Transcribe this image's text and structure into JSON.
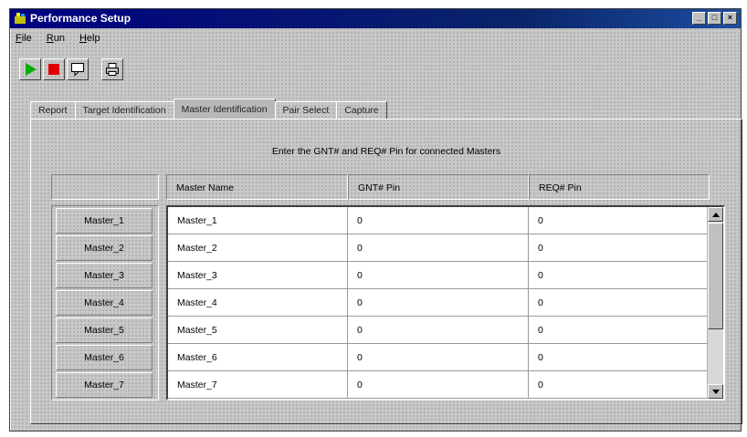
{
  "window": {
    "title": "Performance Setup"
  },
  "menu": [
    {
      "accel": "F",
      "rest": "ile"
    },
    {
      "accel": "R",
      "rest": "un"
    },
    {
      "accel": "H",
      "rest": "elp"
    }
  ],
  "toolbar": {
    "run_icon": "play-icon",
    "stop_icon": "stop-icon",
    "config_icon": "chat-icon",
    "print_icon": "printer-icon",
    "colors": {
      "run": "#00b000",
      "stop": "#e00000"
    }
  },
  "tabs": [
    {
      "label": "Report"
    },
    {
      "label": "Target Identification"
    },
    {
      "label": "Master Identification"
    },
    {
      "label": "Pair Select"
    },
    {
      "label": "Capture"
    }
  ],
  "panel": {
    "instruction": "Enter the GNT# and REQ# Pin for connected Masters",
    "columns": [
      "Master Name",
      "GNT# Pin",
      "REQ# Pin"
    ],
    "row_headers": [
      "Master_1",
      "Master_2",
      "Master_3",
      "Master_4",
      "Master_5",
      "Master_6",
      "Master_7"
    ],
    "rows": [
      [
        "Master_1",
        "0",
        "0"
      ],
      [
        "Master_2",
        "0",
        "0"
      ],
      [
        "Master_3",
        "0",
        "0"
      ],
      [
        "Master_4",
        "0",
        "0"
      ],
      [
        "Master_5",
        "0",
        "0"
      ],
      [
        "Master_6",
        "0",
        "0"
      ],
      [
        "Master_7",
        "0",
        "0"
      ]
    ]
  }
}
